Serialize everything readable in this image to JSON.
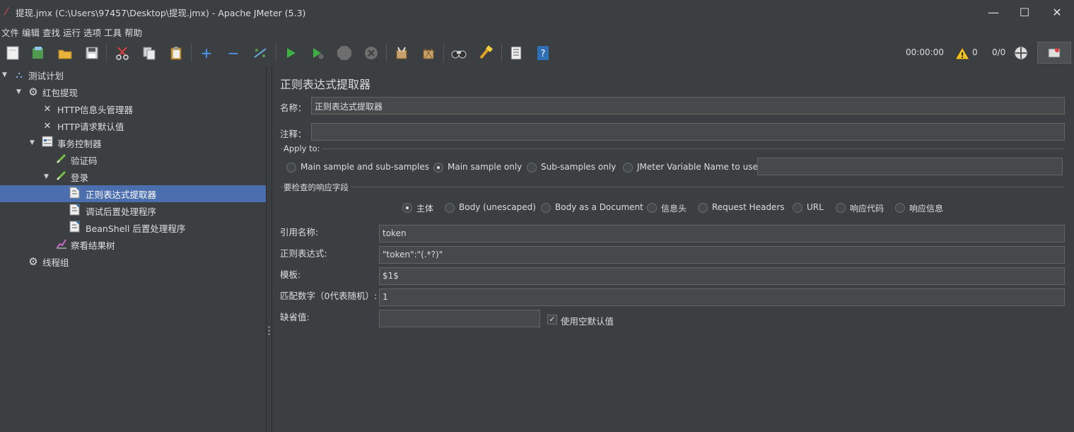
{
  "window": {
    "title": "提现.jmx (C:\\Users\\97457\\Desktop\\提现.jmx) - Apache JMeter (5.3)",
    "minimize": "—",
    "maximize": "☐",
    "close": "✕"
  },
  "menu": [
    "文件",
    "编辑",
    "查找",
    "运行",
    "选项",
    "工具",
    "帮助"
  ],
  "toolbar": {
    "timer": "00:00:00",
    "warnings": "0",
    "threads": "0/0",
    "icons": [
      "new-icon",
      "templates-icon",
      "open-icon",
      "save-icon",
      "cut-icon",
      "copy-icon",
      "paste-icon",
      "expand-icon",
      "collapse-icon",
      "toggle-icon",
      "start-icon",
      "start-no-pause-icon",
      "stop-icon",
      "shutdown-icon",
      "clear-icon",
      "clear-all-icon",
      "search-icon",
      "reset-search-icon",
      "function-helper-icon",
      "help-icon"
    ]
  },
  "tree": [
    {
      "label": "测试计划",
      "icon": "test-plan-icon"
    },
    {
      "label": "红包提现",
      "icon": "thread-group-icon"
    },
    {
      "label": "HTTP信息头管理器",
      "icon": "config-tool-icon"
    },
    {
      "label": "HTTP请求默认值",
      "icon": "config-tool-icon"
    },
    {
      "label": "事务控制器",
      "icon": "controller-icon"
    },
    {
      "label": "验证码",
      "icon": "sampler-icon"
    },
    {
      "label": "登录",
      "icon": "sampler-icon"
    },
    {
      "label": "正则表达式提取器",
      "icon": "post-processor-icon"
    },
    {
      "label": "调试后置处理程序",
      "icon": "post-processor-icon"
    },
    {
      "label": "BeanShell 后置处理程序",
      "icon": "post-processor-icon"
    },
    {
      "label": "察看结果树",
      "icon": "listener-icon"
    },
    {
      "label": "线程组",
      "icon": "thread-group-icon"
    }
  ],
  "editor": {
    "title": "正则表达式提取器",
    "name_label": "名称：",
    "name_value": "正则表达式提取器",
    "comment_label": "注释：",
    "comment_value": "",
    "apply_to_label": "Apply to:",
    "apply_to_options": [
      "Main sample and sub-samples",
      "Main sample only",
      "Sub-samples only",
      "JMeter Variable Name to use"
    ],
    "apply_to_selected": "Main sample only",
    "jmeter_var_value": "",
    "field_section_label": "要检查的响应字段",
    "field_options": [
      "主体",
      "Body (unescaped)",
      "Body as a Document",
      "信息头",
      "Request Headers",
      "URL",
      "响应代码",
      "响应信息"
    ],
    "field_selected": "主体",
    "ref_name_label": "引用名称:",
    "ref_name_value": "token",
    "regex_label": "正则表达式:",
    "regex_value": "\"token\":\"(.*?)\"",
    "template_label": "模板:",
    "template_value": "$1$",
    "match_no_label": "匹配数字（0代表随机）:",
    "match_no_value": "1",
    "default_label": "缺省值:",
    "default_value": "",
    "use_empty_default_label": "使用空默认值",
    "use_empty_default_checked": "✓"
  }
}
